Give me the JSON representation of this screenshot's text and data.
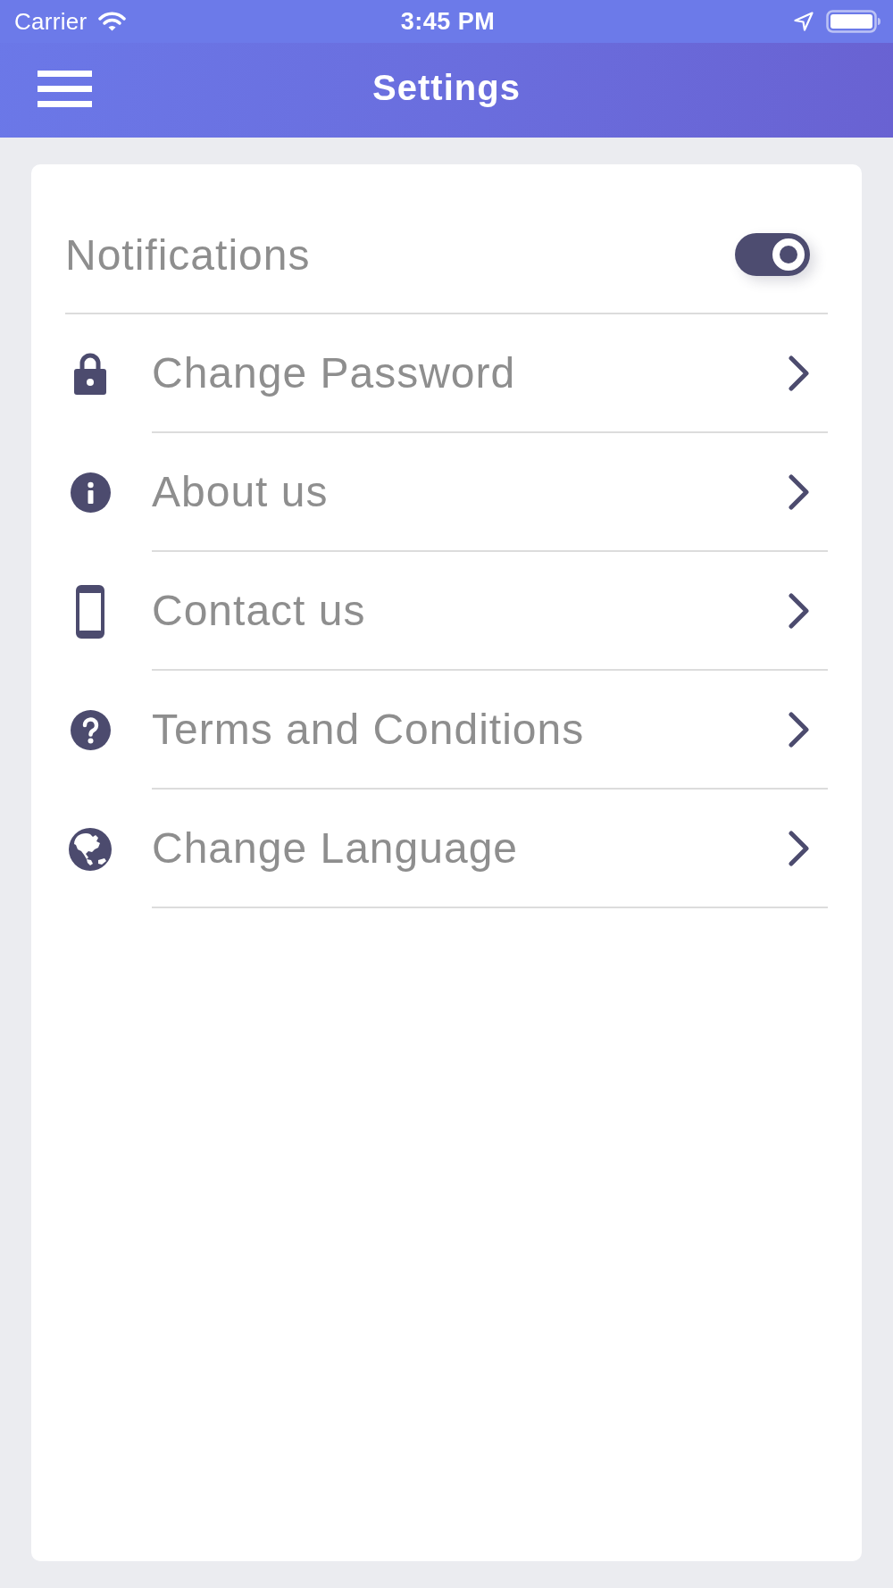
{
  "status_bar": {
    "carrier": "Carrier",
    "time": "3:45 PM"
  },
  "header": {
    "title": "Settings"
  },
  "notifications": {
    "label": "Notifications",
    "on": true
  },
  "menu_items": [
    {
      "label": "Change Password"
    },
    {
      "label": "About us"
    },
    {
      "label": "Contact us"
    },
    {
      "label": "Terms and Conditions"
    },
    {
      "label": "Change Language"
    }
  ]
}
